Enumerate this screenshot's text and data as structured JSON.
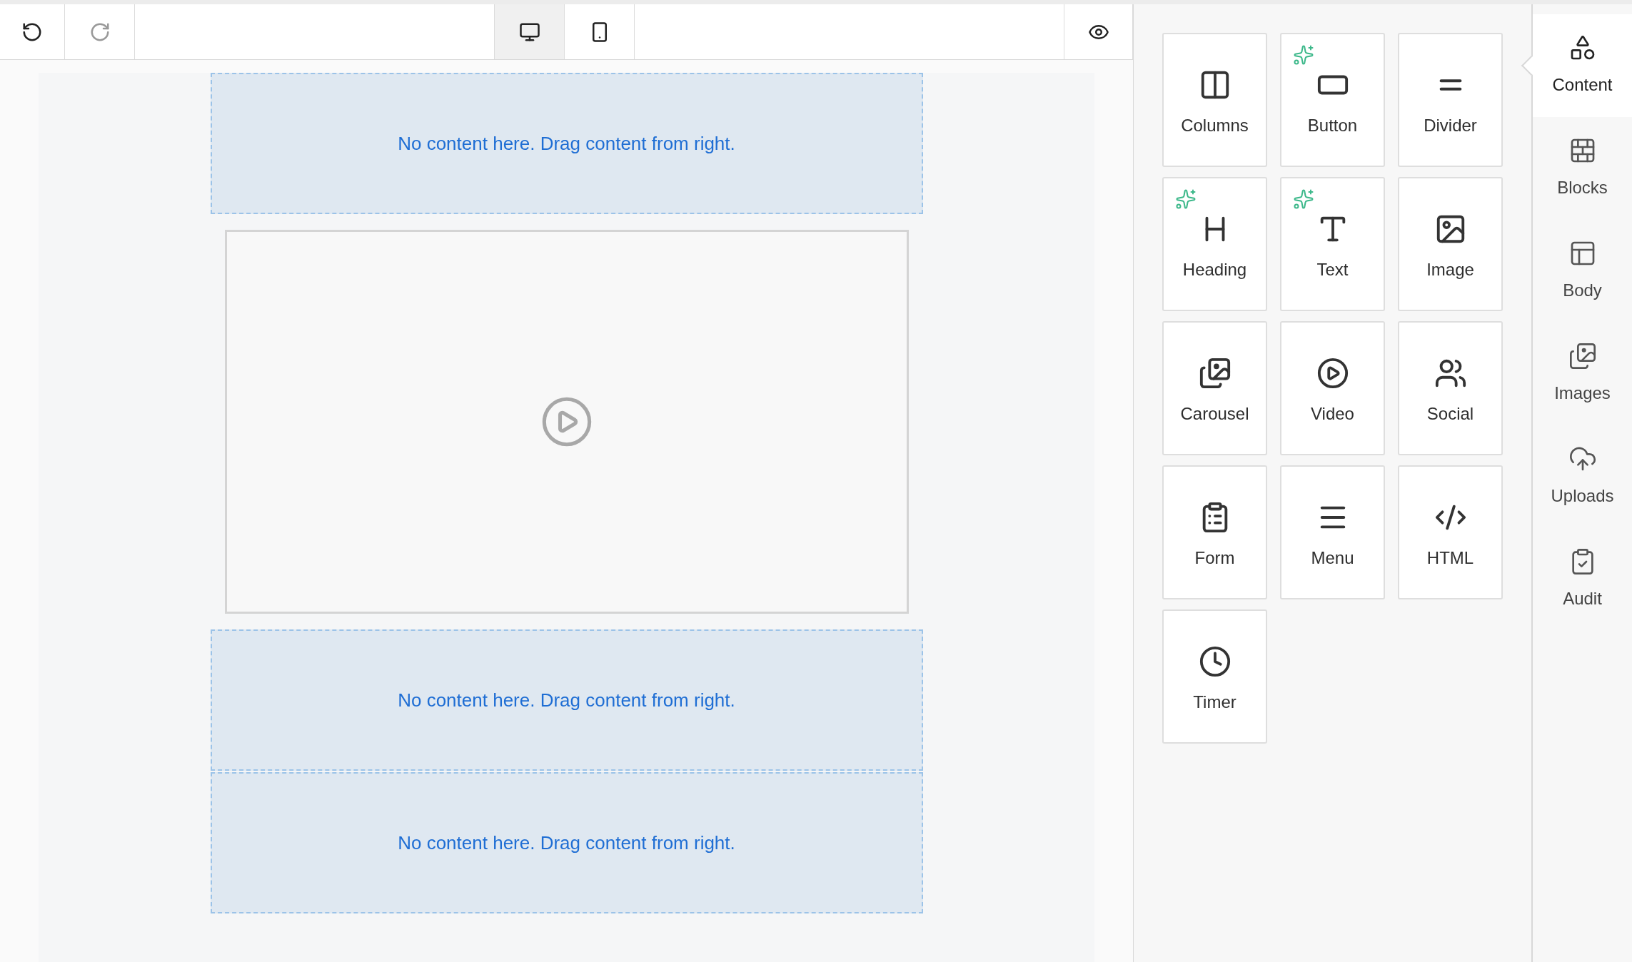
{
  "toolbar": {
    "history": [
      {
        "kind": "undo",
        "disabled": false
      },
      {
        "kind": "redo",
        "disabled": true
      }
    ],
    "devices": [
      {
        "kind": "desktop",
        "selected": true
      },
      {
        "kind": "mobile",
        "selected": false
      }
    ],
    "preview": {
      "kind": "preview"
    }
  },
  "canvas": {
    "rows": [
      {
        "kind": "empty",
        "text": "No content here. Drag content from right."
      },
      {
        "kind": "video"
      },
      {
        "kind": "empty",
        "text": "No content here. Drag content from right."
      },
      {
        "kind": "empty",
        "text": "No content here. Drag content from right."
      }
    ]
  },
  "tools": [
    {
      "kind": "columns",
      "label": "Columns",
      "ai": false
    },
    {
      "kind": "button",
      "label": "Button",
      "ai": true
    },
    {
      "kind": "divider",
      "label": "Divider",
      "ai": false
    },
    {
      "kind": "heading",
      "label": "Heading",
      "ai": true
    },
    {
      "kind": "text",
      "label": "Text",
      "ai": true
    },
    {
      "kind": "image",
      "label": "Image",
      "ai": false
    },
    {
      "kind": "carousel",
      "label": "Carousel",
      "ai": false
    },
    {
      "kind": "video",
      "label": "Video",
      "ai": false
    },
    {
      "kind": "social",
      "label": "Social",
      "ai": false
    },
    {
      "kind": "form",
      "label": "Form",
      "ai": false
    },
    {
      "kind": "menu",
      "label": "Menu",
      "ai": false
    },
    {
      "kind": "html",
      "label": "HTML",
      "ai": false
    },
    {
      "kind": "timer",
      "label": "Timer",
      "ai": false
    }
  ],
  "sidebar": {
    "items": [
      {
        "kind": "content",
        "label": "Content",
        "selected": true
      },
      {
        "kind": "blocks",
        "label": "Blocks",
        "selected": false
      },
      {
        "kind": "body",
        "label": "Body",
        "selected": false
      },
      {
        "kind": "images",
        "label": "Images",
        "selected": false
      },
      {
        "kind": "uploads",
        "label": "Uploads",
        "selected": false
      },
      {
        "kind": "audit",
        "label": "Audit",
        "selected": false
      }
    ]
  }
}
